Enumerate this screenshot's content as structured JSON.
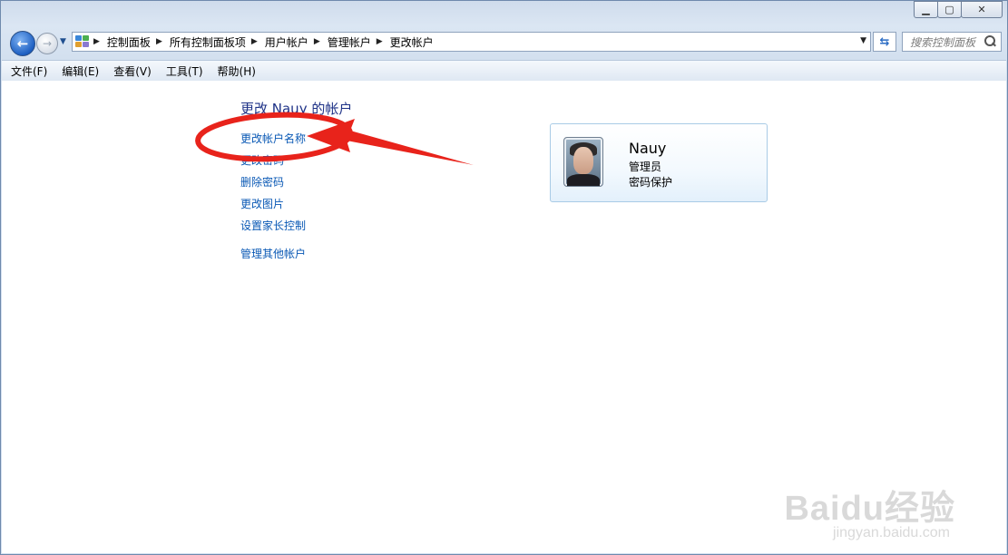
{
  "window": {
    "caption_buttons": [
      "minimize",
      "maximize",
      "close"
    ]
  },
  "nav": {
    "breadcrumb": [
      "控制面板",
      "所有控制面板项",
      "用户帐户",
      "管理帐户",
      "更改帐户"
    ],
    "search_placeholder": "搜索控制面板"
  },
  "menubar": {
    "items": [
      "文件(F)",
      "编辑(E)",
      "查看(V)",
      "工具(T)",
      "帮助(H)"
    ]
  },
  "main": {
    "title": "更改 Nauy 的帐户",
    "links": [
      "更改帐户名称",
      "更改密码",
      "删除密码",
      "更改图片",
      "设置家长控制"
    ],
    "other_link": "管理其他帐户"
  },
  "account": {
    "name": "Nauy",
    "role": "管理员",
    "status": "密码保护"
  },
  "annotation": {
    "color": "#e8231b"
  },
  "watermark": {
    "logo": "Baidu经验",
    "url": "jingyan.baidu.com"
  }
}
